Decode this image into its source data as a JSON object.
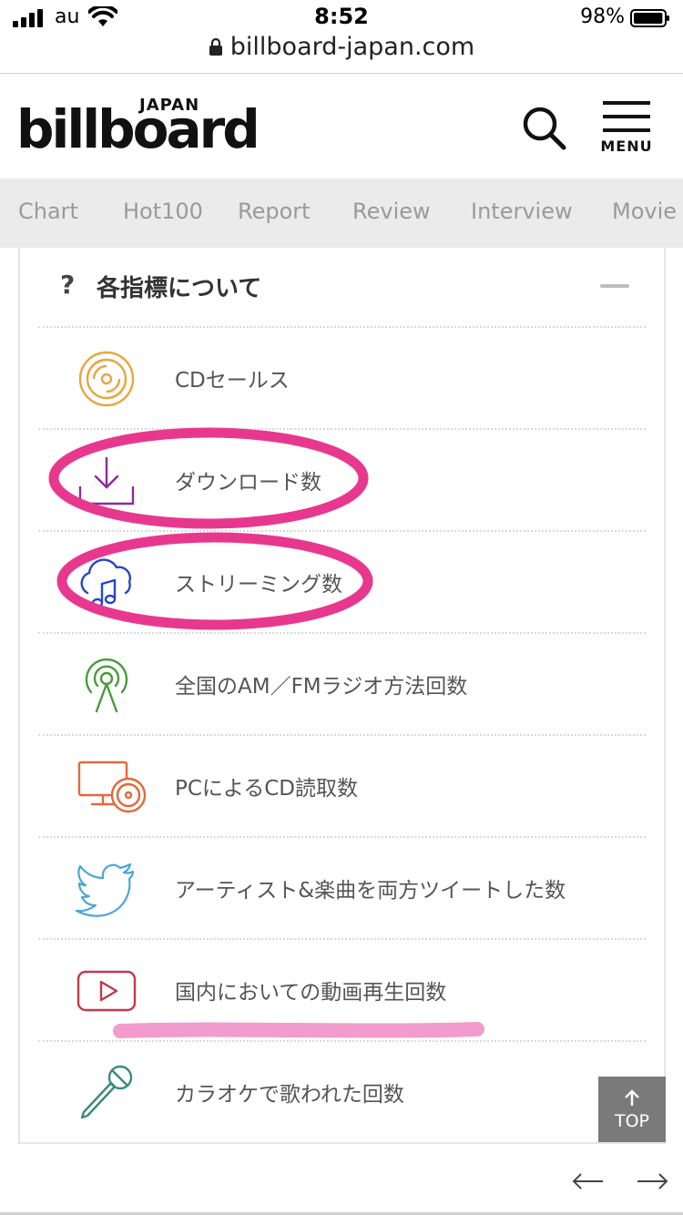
{
  "status_bar": {
    "carrier": "au",
    "time": "8:52",
    "battery_percent": "98%",
    "battery_level": 0.98
  },
  "browser": {
    "url": "billboard-japan.com"
  },
  "header": {
    "logo_text": "billboard",
    "logo_sub": "JAPAN",
    "menu_label": "MENU"
  },
  "tabs": [
    {
      "label": "Chart"
    },
    {
      "label": "Hot100"
    },
    {
      "label": "Report"
    },
    {
      "label": "Review"
    },
    {
      "label": "Interview"
    },
    {
      "label": "Movie"
    }
  ],
  "panel": {
    "question_mark": "?",
    "title": "各指標について",
    "items": [
      {
        "label": "CDセールス",
        "icon": "cd-disc-icon",
        "color": "#e8a640"
      },
      {
        "label": "ダウンロード数",
        "icon": "download-icon",
        "color": "#8e2a9c"
      },
      {
        "label": "ストリーミング数",
        "icon": "cloud-music-icon",
        "color": "#2746c4"
      },
      {
        "label": "全国のAM／FMラジオ方法回数",
        "icon": "radio-antenna-icon",
        "color": "#4a9a3c"
      },
      {
        "label": "PCによるCD読取数",
        "icon": "pc-cd-icon",
        "color": "#e06a3a"
      },
      {
        "label": "アーティスト&楽曲を両方ツイートした数",
        "icon": "twitter-bird-icon",
        "color": "#4aa6dc"
      },
      {
        "label": "国内においての動画再生回数",
        "icon": "video-play-icon",
        "color": "#c03a4e"
      },
      {
        "label": "カラオケで歌われた回数",
        "icon": "microphone-icon",
        "color": "#3a8a7a"
      }
    ]
  },
  "annotations": {
    "circle_color": "#e8388e",
    "underline_color": "#f08ac4"
  },
  "top_button": {
    "label": "TOP"
  },
  "footer_nav": {
    "back_icon": "arrow-left-icon",
    "forward_icon": "arrow-right-icon"
  }
}
